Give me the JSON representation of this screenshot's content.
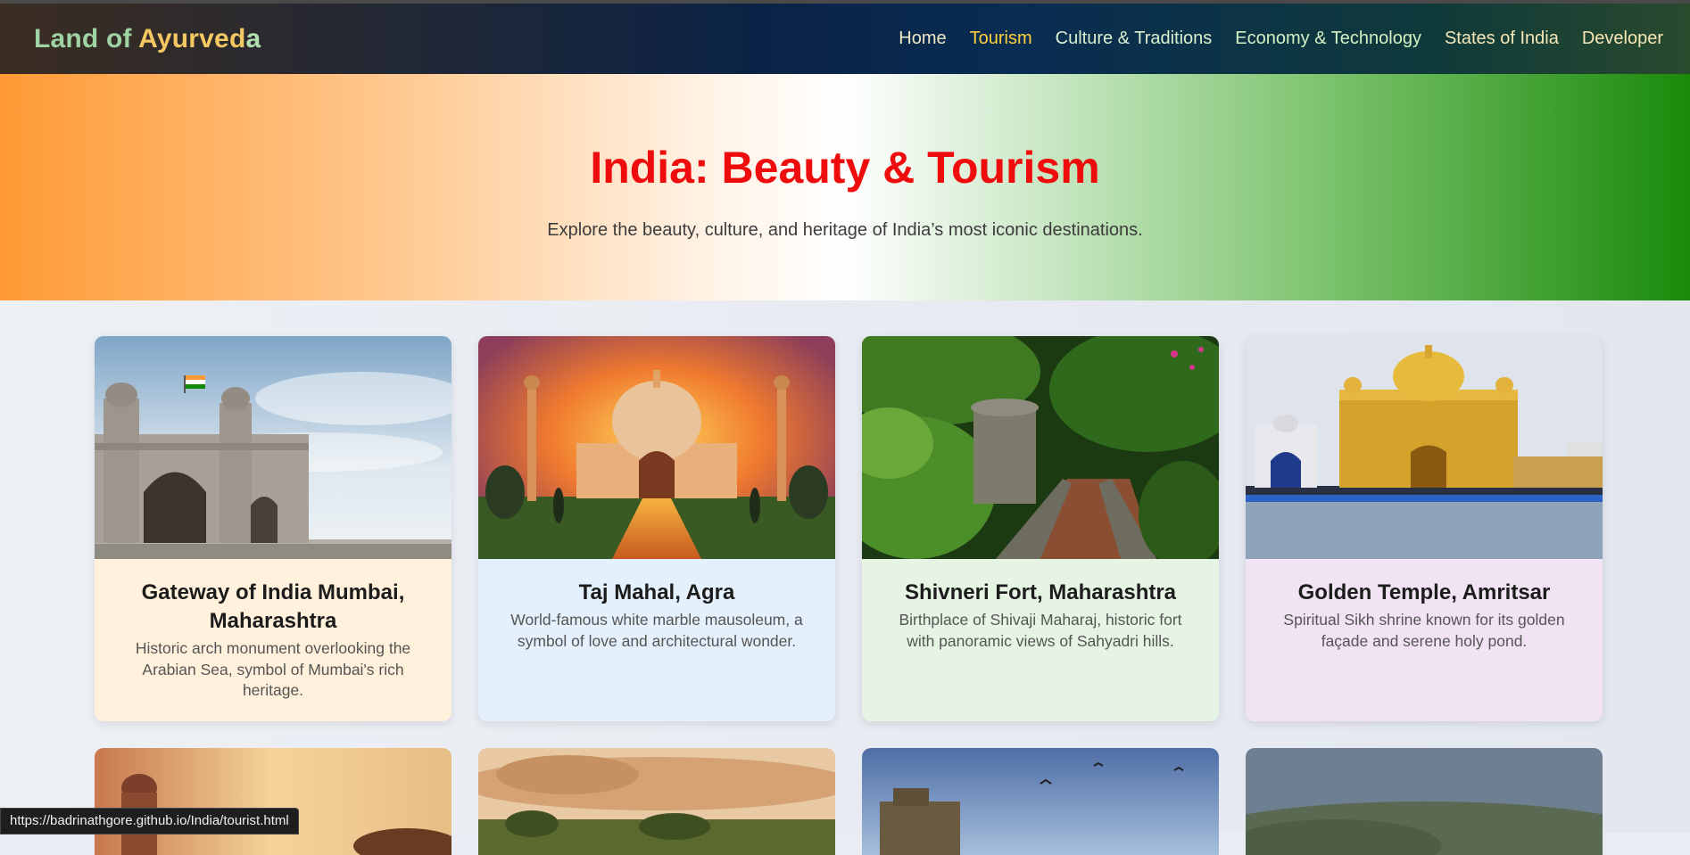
{
  "brand": {
    "part1": "Land of ",
    "part2": "Ayurved",
    "part3": "a"
  },
  "nav": {
    "items": [
      {
        "label": "Home"
      },
      {
        "label": "Tourism"
      },
      {
        "label": "Culture & Traditions"
      },
      {
        "label": "Economy & Technology"
      },
      {
        "label": "States of India"
      },
      {
        "label": "Developer"
      }
    ],
    "active": "Tourism"
  },
  "hero": {
    "title": "India: Beauty & Tourism",
    "subtitle": "Explore the beauty, culture, and heritage of India’s most iconic destinations."
  },
  "cards": [
    {
      "title": "Gateway of India Mumbai, Maharashtra",
      "description": "Historic arch monument overlooking the Arabian Sea, symbol of Mumbai's rich heritage.",
      "bg": "#fff1dc"
    },
    {
      "title": "Taj Mahal, Agra",
      "description": "World-famous white marble mausoleum, a symbol of love and architectural wonder.",
      "bg": "#e4f0fc"
    },
    {
      "title": "Shivneri Fort, Maharashtra",
      "description": "Birthplace of Shivaji Maharaj, historic fort with panoramic views of Sahyadri hills.",
      "bg": "#e6f4e4"
    },
    {
      "title": "Golden Temple, Amritsar",
      "description": "Spiritual Sikh shrine known for its golden façade and serene holy pond.",
      "bg": "#f1e3f4"
    }
  ],
  "status_url": "https://badrinathgore.github.io/India/tourist.html",
  "colors": {
    "hero_title": "#ee0c0c",
    "nav_active": "#ffd23c",
    "saffron": "#ff9a35",
    "green": "#1a8a0b"
  }
}
